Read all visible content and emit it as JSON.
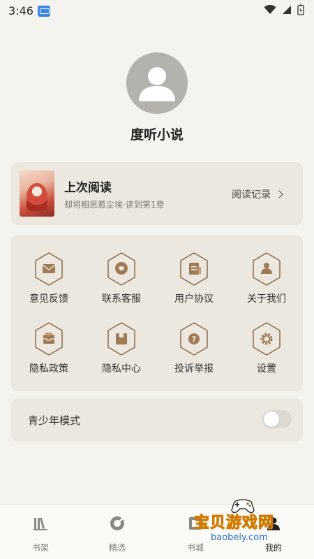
{
  "status_bar": {
    "time": "3:46"
  },
  "profile": {
    "username": "度听小说"
  },
  "last_read": {
    "title": "上次阅读",
    "subtitle": "却将相思惹尘埃·读到第1章",
    "history_label": "阅读记录"
  },
  "grid": [
    {
      "label": "意见反馈",
      "icon": "envelope-icon"
    },
    {
      "label": "联系客服",
      "icon": "chat-heart-icon"
    },
    {
      "label": "用户协议",
      "icon": "document-icon"
    },
    {
      "label": "关于我们",
      "icon": "person-icon"
    },
    {
      "label": "隐私政策",
      "icon": "inbox-icon"
    },
    {
      "label": "隐私中心",
      "icon": "box-icon"
    },
    {
      "label": "投诉举报",
      "icon": "question-icon"
    },
    {
      "label": "设置",
      "icon": "gear-icon"
    }
  ],
  "teen_mode": {
    "label": "青少年模式",
    "enabled": false
  },
  "bottom_nav": [
    {
      "label": "书架",
      "icon": "bookshelf-icon",
      "active": false
    },
    {
      "label": "精选",
      "icon": "featured-icon",
      "active": false
    },
    {
      "label": "书城",
      "icon": "bookstore-icon",
      "active": false
    },
    {
      "label": "我的",
      "icon": "profile-icon",
      "active": true
    }
  ],
  "watermark": {
    "text": "宝贝游戏网",
    "url": "baobeiy.com"
  },
  "colors": {
    "accent": "#8a6a4a",
    "icon_fill": "#a07a55",
    "background": "#f5f3ee",
    "card": "#ede8df"
  }
}
